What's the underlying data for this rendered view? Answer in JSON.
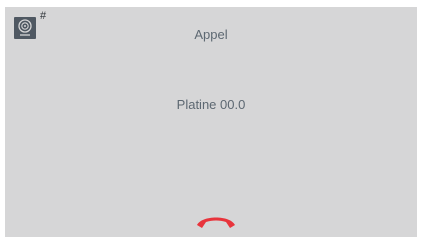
{
  "header": {
    "title": "Appel",
    "device_icon": "doorbell-panel-icon",
    "hash_label": "#"
  },
  "main": {
    "status_text": "Platine 00.0"
  },
  "controls": {
    "hangup_icon": "hang-up-phone-icon",
    "hangup_color": "#e8343c"
  },
  "colors": {
    "background": "#d6d6d7",
    "text": "#5d6872",
    "icon_bg": "#4f5862"
  }
}
